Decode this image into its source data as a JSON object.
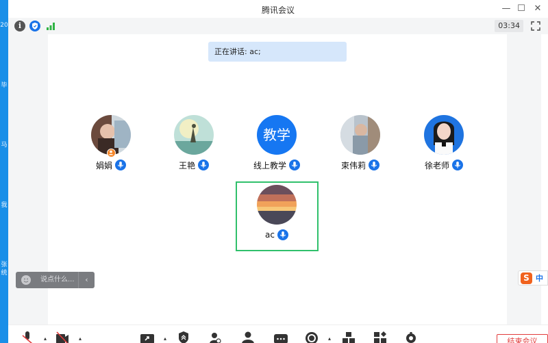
{
  "window": {
    "title": "腾讯会议",
    "minimize": "—",
    "maximize": "☐",
    "close": "✕"
  },
  "desktop_edge": [
    "20",
    "毕",
    "马",
    "我",
    "张",
    "统"
  ],
  "infobar": {
    "timer": "03:34",
    "info_glyph": "i"
  },
  "speaking": {
    "text": "正在讲话: ac;"
  },
  "participants": [
    {
      "name": "娟娟",
      "host": true,
      "icon": "photo-avatar"
    },
    {
      "name": "王艳",
      "host": false,
      "icon": "photo-avatar"
    },
    {
      "name": "线上教学",
      "host": false,
      "initials": "教学"
    },
    {
      "name": "束伟莉",
      "host": false,
      "icon": "photo-avatar"
    },
    {
      "name": "徐老师",
      "host": false,
      "icon": "photo-avatar"
    },
    {
      "name": "ac",
      "host": false,
      "icon": "sunset-avatar",
      "active": true
    }
  ],
  "chat": {
    "placeholder": "说点什么...",
    "collapse": "‹"
  },
  "ime": {
    "logo": "S",
    "mode": "中"
  },
  "toolbar": {
    "end_label": "结束会议",
    "icons": [
      "mic-muted-icon",
      "camera-off-icon",
      "share-screen-icon",
      "security-icon",
      "members-icon",
      "invite-icon",
      "chat-icon",
      "record-icon",
      "apps-icon",
      "layout-icon",
      "settings-icon"
    ]
  },
  "colors": {
    "accent": "#1a73e8",
    "active_border": "#2fc06b",
    "danger": "#e23b3b",
    "banner": "#d6e7fb"
  }
}
